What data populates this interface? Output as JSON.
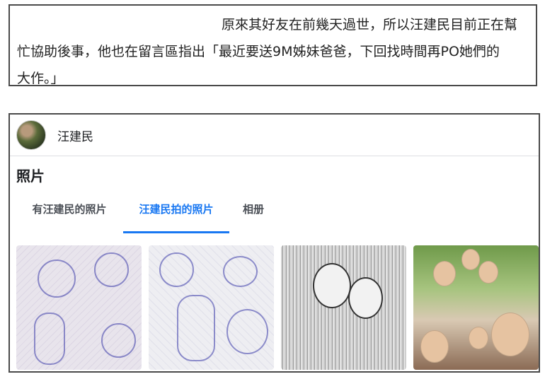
{
  "quote": {
    "line1": "原來其好友在前幾天過世，所以汪建民目前正在幫",
    "line2": "忙協助後事，他也在留言區指出「最近要送9M姊妹爸爸，下回找時間再PO她們的",
    "line3": "大作。」"
  },
  "profile": {
    "name": "汪建民"
  },
  "photos_section": {
    "title": "照片",
    "tabs": [
      "有汪建民的照片",
      "汪建民拍的照片",
      "相册"
    ],
    "active_tab_index": 1,
    "photos": [
      {
        "desc": "sketch-drawing-1"
      },
      {
        "desc": "sketch-drawing-2"
      },
      {
        "desc": "black-white-portrait"
      },
      {
        "desc": "group-selfie"
      }
    ]
  },
  "colors": {
    "accent": "#1877f2",
    "border": "#4a4a4a"
  }
}
